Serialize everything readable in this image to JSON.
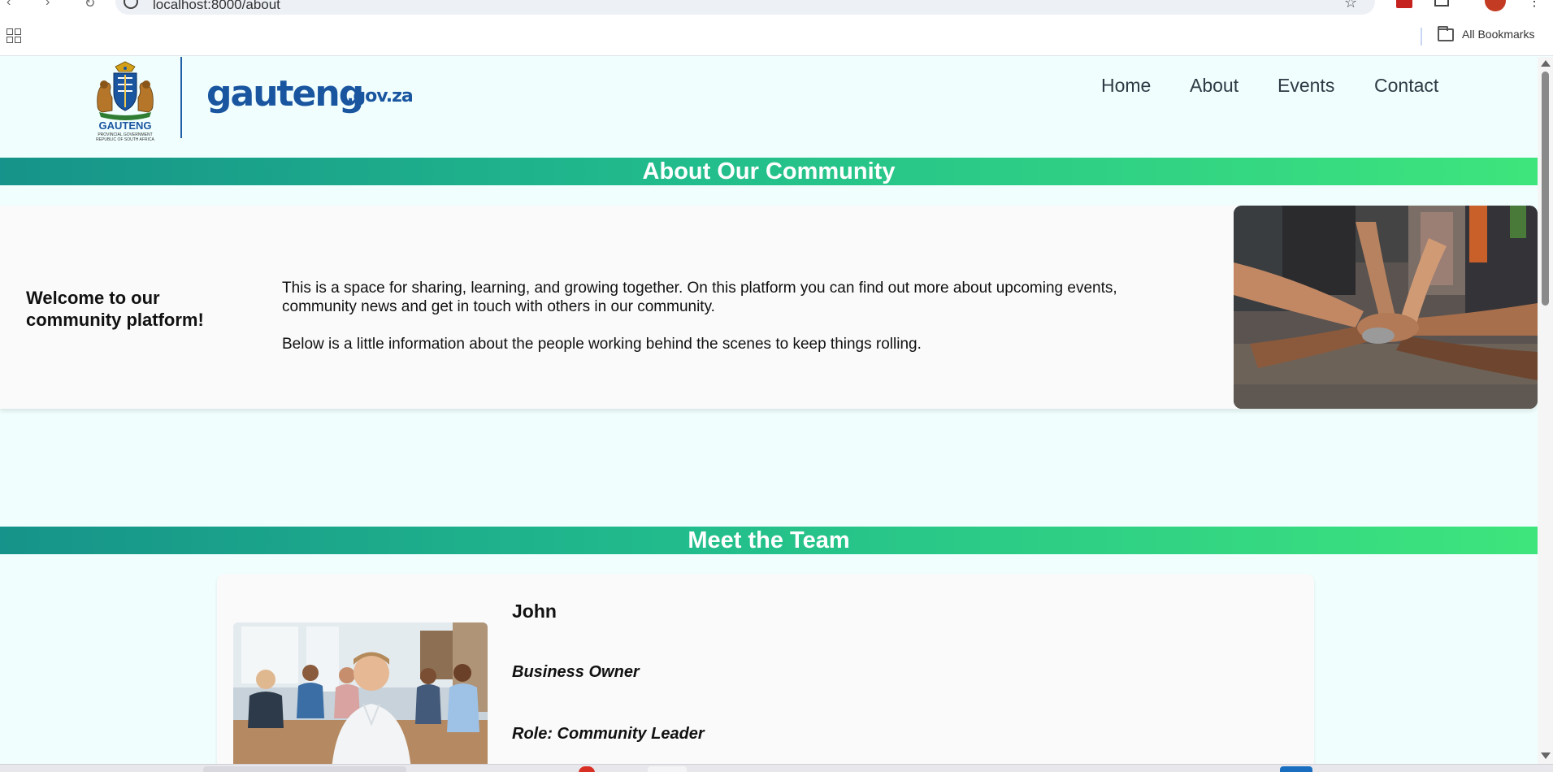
{
  "browser": {
    "url": "localhost:8000/about",
    "bookmarks_label": "All Bookmarks",
    "profile_color": "#c23b22"
  },
  "header": {
    "logo_name": "GAUTENG",
    "logo_sub1": "PROVINCIAL GOVERNMENT",
    "logo_sub2": "REPUBLIC OF SOUTH AFRICA",
    "wordmark": "gauteng",
    "wordmark_suffix": ".gov.za",
    "nav": [
      "Home",
      "About",
      "Events",
      "Contact"
    ]
  },
  "about": {
    "heading": "About Our Community",
    "welcome": "Welcome to our community platform!",
    "paragraph1": "This is a space for sharing, learning, and growing together. On this platform you can find out more about upcoming events, community news and get in touch with others in our community.",
    "paragraph2": "Below is a little information about the people working behind the scenes to keep things rolling."
  },
  "team": {
    "heading": "Meet the Team",
    "members": [
      {
        "name": "John",
        "title": "Business Owner",
        "role": "Role: Community Leader"
      }
    ]
  },
  "colors": {
    "banner_start": "#16938a",
    "banner_end": "#3ee57c",
    "brand_blue": "#1a56a0",
    "page_bg": "#f0fefe"
  }
}
